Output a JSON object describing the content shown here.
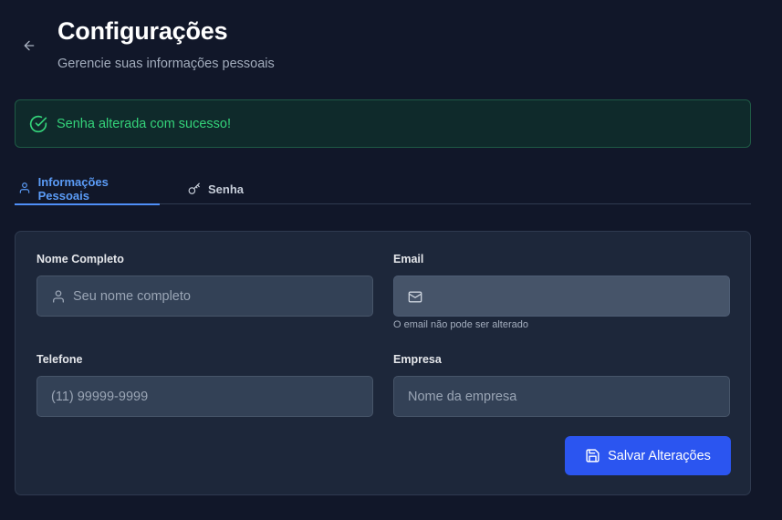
{
  "header": {
    "title": "Configurações",
    "subtitle": "Gerencie suas informações pessoais"
  },
  "alert": {
    "message": "Senha alterada com sucesso!",
    "icon": "check-circle-icon",
    "color": "#34d37a"
  },
  "tabs": [
    {
      "label": "Informações Pessoais",
      "icon": "user-icon",
      "active": true
    },
    {
      "label": "Senha",
      "icon": "key-icon",
      "active": false
    }
  ],
  "form": {
    "name": {
      "label": "Nome Completo",
      "placeholder": "Seu nome completo",
      "value": "",
      "icon": "user-icon"
    },
    "email": {
      "label": "Email",
      "value": "",
      "icon": "mail-icon",
      "hint": "O email não pode ser alterado",
      "disabled": true
    },
    "phone": {
      "label": "Telefone",
      "placeholder": "(11) 99999-9999",
      "value": ""
    },
    "company": {
      "label": "Empresa",
      "placeholder": "Nome da empresa",
      "value": ""
    },
    "save_label": "Salvar Alterações",
    "save_icon": "save-icon"
  },
  "colors": {
    "background": "#111729",
    "card": "#1d273a",
    "accent": "#2b55f0",
    "tab_active": "#5b9cf7",
    "success": "#34d37a"
  }
}
